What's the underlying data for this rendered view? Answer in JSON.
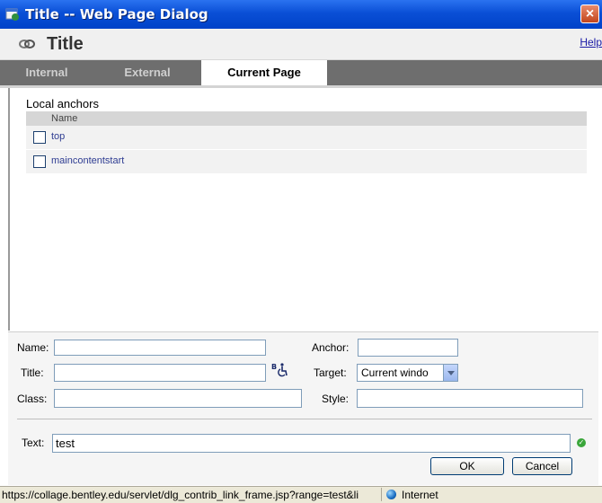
{
  "window": {
    "title": "Title -- Web Page Dialog",
    "close_label": "×"
  },
  "header": {
    "title": "Title",
    "help_label": "Help"
  },
  "tabs": [
    {
      "label": "Internal",
      "active": false
    },
    {
      "label": "External",
      "active": false
    },
    {
      "label": "Current Page",
      "active": true
    }
  ],
  "anchors": {
    "section_label": "Local anchors",
    "column_header": "Name",
    "items": [
      {
        "name": "top"
      },
      {
        "name": "maincontentstart"
      }
    ]
  },
  "form": {
    "name_label": "Name:",
    "name_value": "",
    "anchor_label": "Anchor:",
    "anchor_value": "",
    "title_label": "Title:",
    "title_value": "",
    "target_label": "Target:",
    "target_value": "Current windo",
    "class_label": "Class:",
    "class_value": "",
    "style_label": "Style:",
    "style_value": "",
    "text_label": "Text:",
    "text_value": "test",
    "ok_label": "OK",
    "cancel_label": "Cancel"
  },
  "statusbar": {
    "url": "https://collage.bentley.edu/servlet/dlg_contrib_link_frame.jsp?range=test&li",
    "zone": "Internet"
  },
  "colors": {
    "titlebar": "#0a4fd6",
    "tabbar": "#6e6e6e",
    "link": "#2e3c92"
  },
  "icons": [
    "app-icon",
    "close-icon",
    "link-icon",
    "accessibility-icon",
    "check-icon",
    "globe-icon",
    "chevron-down-icon"
  ]
}
